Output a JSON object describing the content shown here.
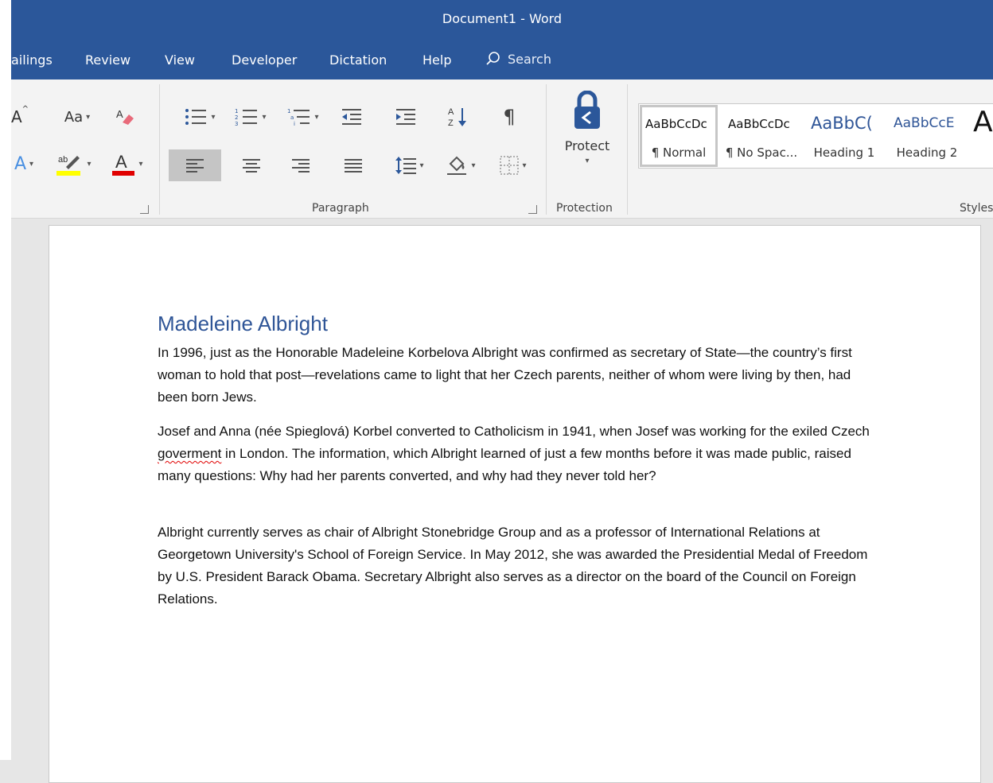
{
  "window": {
    "title": "Document1  -  Word"
  },
  "tabs": [
    "ailings",
    "Review",
    "View",
    "Developer",
    "Dictation",
    "Help"
  ],
  "search": {
    "label": "Search"
  },
  "ribbon": {
    "font_group": {
      "change_case": "Aa"
    },
    "paragraph_label": "Paragraph",
    "protection_label": "Protection",
    "protect_label": "Protect",
    "styles_label": "Styles",
    "styles": [
      {
        "sample": "AaBbCcDc",
        "name": "¶ Normal",
        "selected": true
      },
      {
        "sample": "AaBbCcDc",
        "name": "¶ No Spac..."
      },
      {
        "sample": "AaBbC(",
        "name": "Heading 1"
      },
      {
        "sample": "AaBbCcE",
        "name": "Heading 2"
      },
      {
        "sample": "A",
        "name": ""
      }
    ]
  },
  "document": {
    "heading": "Madeleine Albright",
    "p1": "In 1996, just as the Honorable Madeleine Korbelova Albright was confirmed as secretary of State—the country’s first woman to hold that post—revelations came to light that her Czech parents, neither of whom were living by then, had been born Jews.",
    "p2_before": "Josef and Anna (née Spieglová) Korbel converted to Catholicism in 1941, when Josef was working for the exiled Czech ",
    "p2_misspelled": "goverment",
    "p2_after": " in London. The information, which Albright learned of just a few months before it was made public, raised many questions: Why had her parents converted, and why had they never told her?",
    "p3": "Albright currently serves as chair of Albright Stonebridge Group and as a professor of International Relations at Georgetown University's School of Foreign Service. In May 2012, she was awarded the Presidential Medal of Freedom by U.S. President Barack Obama. Secretary Albright also serves as a director on the board of the Council on Foreign Relations."
  },
  "colors": {
    "title_bar": "#2b579a",
    "heading": "#2f5597",
    "highlight": "#ffff00",
    "font_color": "#e00000",
    "spell_error": "#e00000"
  }
}
